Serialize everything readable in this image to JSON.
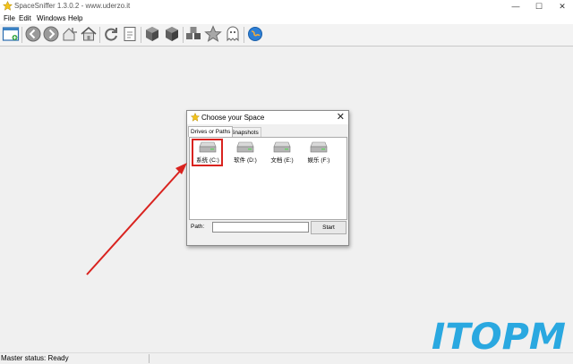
{
  "window": {
    "title": "SpaceSniffer 1.3.0.2 - www.uderzo.it",
    "controls": {
      "minimize": "—",
      "maximize": "☐",
      "close": "✕"
    }
  },
  "menu": {
    "items": [
      "File",
      "Edit",
      "Windows",
      "Help"
    ]
  },
  "toolbar": {
    "icons": [
      "new-window-icon",
      "back-icon",
      "forward-icon",
      "go-up-icon",
      "home-icon",
      "refresh-icon",
      "export-icon",
      "cube-icon",
      "filter-icon",
      "star-icon",
      "ghost-icon",
      "web-icon"
    ]
  },
  "dialog": {
    "title": "Choose your Space",
    "close": "✕",
    "tabs": [
      {
        "label": "Drives or Paths",
        "active": true
      },
      {
        "label": "Snapshots",
        "active": false
      }
    ],
    "drives": [
      {
        "label": "系统 (C:)",
        "selected": true
      },
      {
        "label": "软件 (D:)",
        "selected": false
      },
      {
        "label": "文档 (E:)",
        "selected": false
      },
      {
        "label": "娱乐 (F:)",
        "selected": false
      }
    ],
    "path_label": "Path:",
    "path_value": "",
    "start_label": "Start"
  },
  "status": {
    "text": "Master status: Ready"
  },
  "watermark": {
    "text": "ITOPM"
  },
  "colors": {
    "annotation_red": "#d9231f",
    "watermark_blue": "#2aa8e0"
  }
}
